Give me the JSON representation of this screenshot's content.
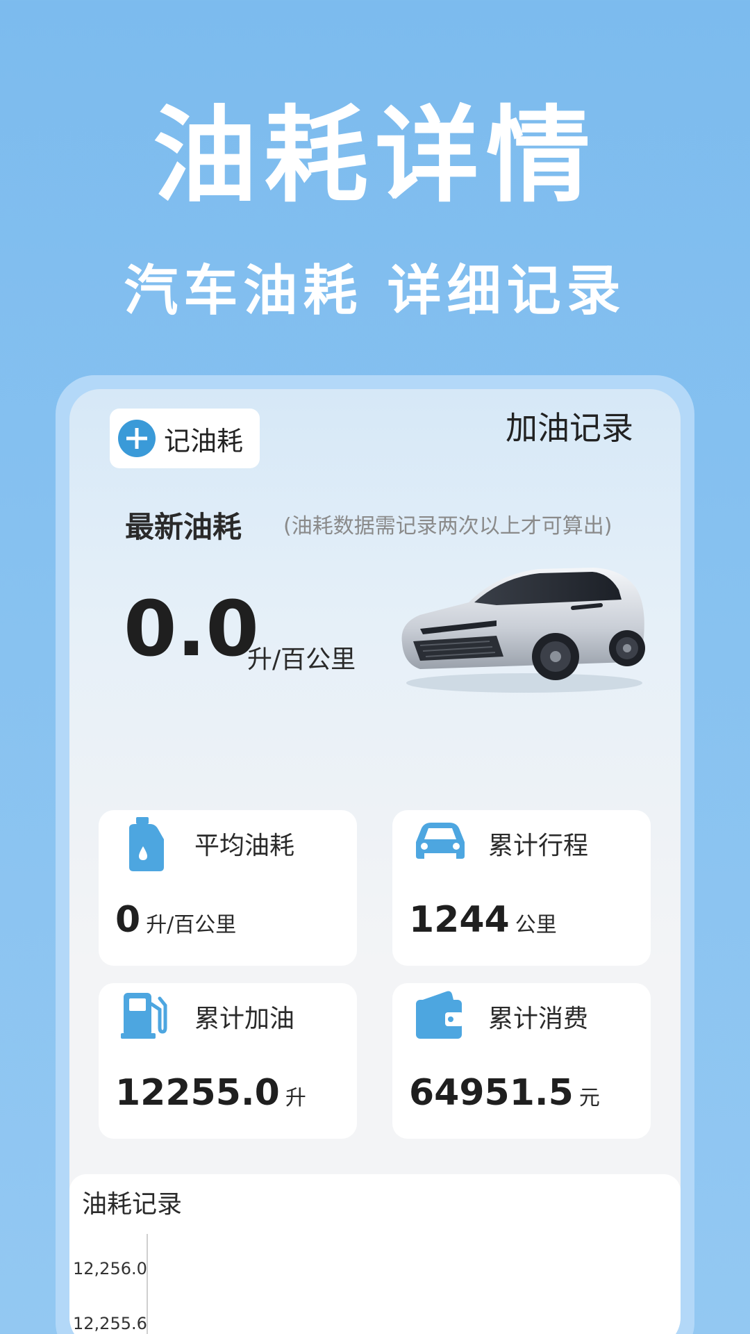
{
  "promo": {
    "title": "油耗详情",
    "subtitle": "汽车油耗 详细记录"
  },
  "app": {
    "add_button_label": "记油耗",
    "records_link": "加油记录",
    "latest": {
      "label": "最新油耗",
      "hint": "(油耗数据需记录两次以上才可算出)",
      "value": "0.0",
      "unit": "升/百公里"
    },
    "stats": [
      {
        "label": "平均油耗",
        "value": "0",
        "unit": "升/百公里",
        "icon": "fuel-can-icon"
      },
      {
        "label": "累计行程",
        "value": "1244",
        "unit": "公里",
        "icon": "car-icon"
      },
      {
        "label": "累计加油",
        "value": "12255.0",
        "unit": "升",
        "icon": "gas-pump-icon"
      },
      {
        "label": "累计消费",
        "value": "64951.5",
        "unit": "元",
        "icon": "wallet-icon"
      }
    ],
    "chart": {
      "title": "油耗记录"
    }
  },
  "chart_data": {
    "type": "line",
    "title": "油耗记录",
    "ytick_labels": [
      "12,256.0",
      "12,255.6"
    ],
    "series": []
  },
  "colors": {
    "background": "#7cbbee",
    "accent": "#3a9ad8",
    "icon_blue": "#4da6e0"
  }
}
